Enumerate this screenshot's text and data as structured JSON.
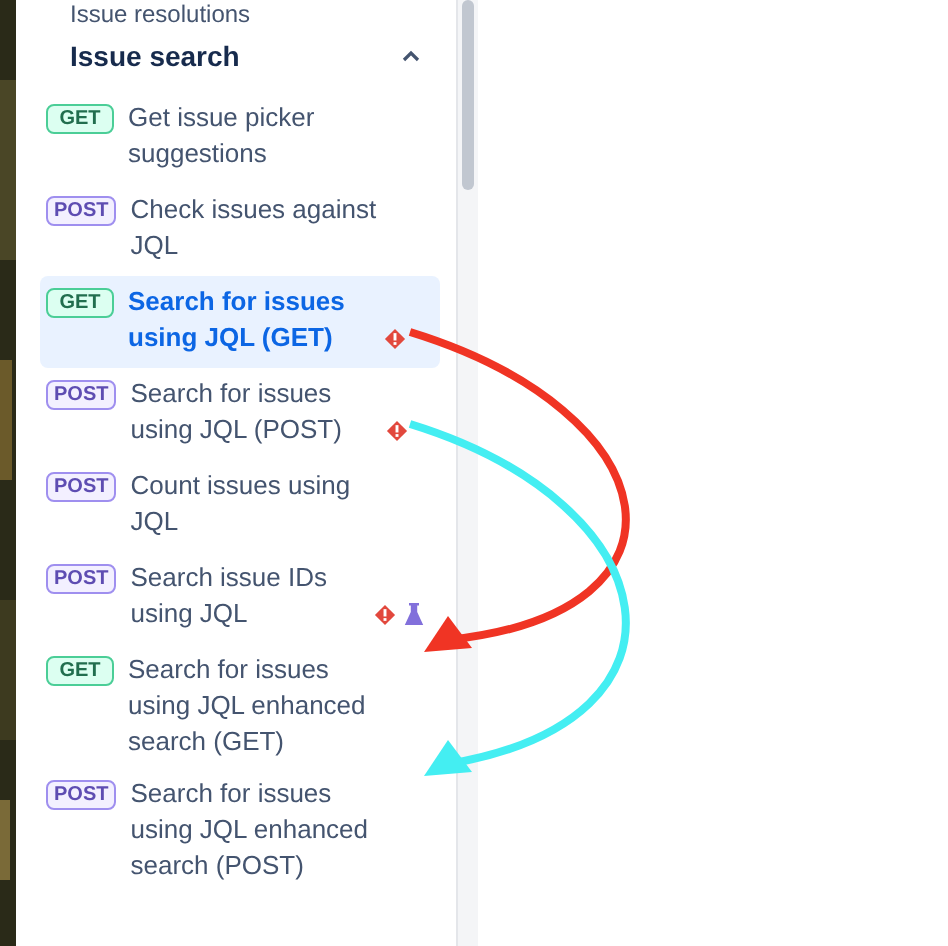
{
  "sidebar": {
    "previous_section": "Issue resolutions",
    "section": {
      "title": "Issue search",
      "expanded": true,
      "items": [
        {
          "method": "GET",
          "label": "Get issue picker suggestions",
          "selected": false
        },
        {
          "method": "POST",
          "label": "Check issues against JQL",
          "selected": false
        },
        {
          "method": "GET",
          "label": "Search for issues using JQL (GET)",
          "selected": true,
          "markers": [
            {
              "kind": "deprecated"
            }
          ]
        },
        {
          "method": "POST",
          "label": "Search for issues using JQL (POST)",
          "selected": false,
          "markers": [
            {
              "kind": "deprecated"
            }
          ]
        },
        {
          "method": "POST",
          "label": "Count issues using JQL",
          "selected": false
        },
        {
          "method": "POST",
          "label": "Search issue IDs using JQL",
          "selected": false,
          "markers": [
            {
              "kind": "deprecated"
            },
            {
              "kind": "experimental"
            }
          ]
        },
        {
          "method": "GET",
          "label": "Search for issues using JQL enhanced search (GET)",
          "selected": false
        },
        {
          "method": "POST",
          "label": "Search for issues using JQL enhanced search (POST)",
          "selected": false
        }
      ]
    }
  },
  "annotations": [
    {
      "kind": "arrow",
      "color": "#f03424"
    },
    {
      "kind": "arrow",
      "color": "#44eef2"
    }
  ]
}
